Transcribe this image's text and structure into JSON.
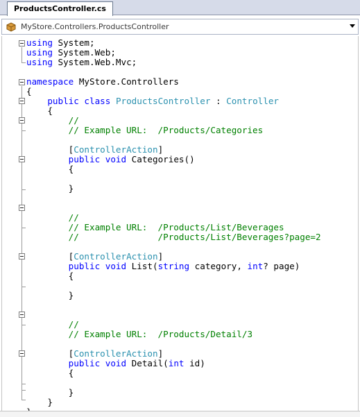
{
  "tab": {
    "title": "ProductsController.cs"
  },
  "navbar": {
    "type_path": "MyStore.Controllers.ProductsController",
    "icon": "class-icon"
  },
  "code_lines": [
    [
      {
        "t": "kw",
        "v": "using"
      },
      {
        "t": "tx",
        "v": " System;"
      }
    ],
    [
      {
        "t": "kw",
        "v": "using"
      },
      {
        "t": "tx",
        "v": " System.Web;"
      }
    ],
    [
      {
        "t": "kw",
        "v": "using"
      },
      {
        "t": "tx",
        "v": " System.Web.Mvc;"
      }
    ],
    [],
    [
      {
        "t": "kw",
        "v": "namespace"
      },
      {
        "t": "tx",
        "v": " MyStore.Controllers"
      }
    ],
    [
      {
        "t": "tx",
        "v": "{"
      }
    ],
    [
      {
        "t": "tx",
        "v": "    "
      },
      {
        "t": "kw",
        "v": "public class"
      },
      {
        "t": "tx",
        "v": " "
      },
      {
        "t": "ty",
        "v": "ProductsController"
      },
      {
        "t": "tx",
        "v": " : "
      },
      {
        "t": "ty",
        "v": "Controller"
      }
    ],
    [
      {
        "t": "tx",
        "v": "    {"
      }
    ],
    [
      {
        "t": "cm",
        "v": "        //"
      }
    ],
    [
      {
        "t": "cm",
        "v": "        // Example URL:  /Products/Categories"
      }
    ],
    [],
    [
      {
        "t": "tx",
        "v": "        ["
      },
      {
        "t": "ty",
        "v": "ControllerAction"
      },
      {
        "t": "tx",
        "v": "]"
      }
    ],
    [
      {
        "t": "tx",
        "v": "        "
      },
      {
        "t": "kw",
        "v": "public void"
      },
      {
        "t": "tx",
        "v": " Categories()"
      }
    ],
    [
      {
        "t": "tx",
        "v": "        {"
      }
    ],
    [],
    [
      {
        "t": "tx",
        "v": "        }"
      }
    ],
    [],
    [],
    [
      {
        "t": "cm",
        "v": "        //"
      }
    ],
    [
      {
        "t": "cm",
        "v": "        // Example URL:  /Products/List/Beverages"
      }
    ],
    [
      {
        "t": "cm",
        "v": "        //               /Products/List/Beverages?page=2"
      }
    ],
    [],
    [
      {
        "t": "tx",
        "v": "        ["
      },
      {
        "t": "ty",
        "v": "ControllerAction"
      },
      {
        "t": "tx",
        "v": "]"
      }
    ],
    [
      {
        "t": "tx",
        "v": "        "
      },
      {
        "t": "kw",
        "v": "public void"
      },
      {
        "t": "tx",
        "v": " List("
      },
      {
        "t": "kw",
        "v": "string"
      },
      {
        "t": "tx",
        "v": " category, "
      },
      {
        "t": "kw",
        "v": "int"
      },
      {
        "t": "tx",
        "v": "? page)"
      }
    ],
    [
      {
        "t": "tx",
        "v": "        {"
      }
    ],
    [],
    [
      {
        "t": "tx",
        "v": "        }"
      }
    ],
    [],
    [],
    [
      {
        "t": "cm",
        "v": "        //"
      }
    ],
    [
      {
        "t": "cm",
        "v": "        // Example URL:  /Products/Detail/3"
      }
    ],
    [],
    [
      {
        "t": "tx",
        "v": "        ["
      },
      {
        "t": "ty",
        "v": "ControllerAction"
      },
      {
        "t": "tx",
        "v": "]"
      }
    ],
    [
      {
        "t": "tx",
        "v": "        "
      },
      {
        "t": "kw",
        "v": "public void"
      },
      {
        "t": "tx",
        "v": " Detail("
      },
      {
        "t": "kw",
        "v": "int"
      },
      {
        "t": "tx",
        "v": " id)"
      }
    ],
    [
      {
        "t": "tx",
        "v": "        {"
      }
    ],
    [],
    [
      {
        "t": "tx",
        "v": "        }"
      }
    ],
    [
      {
        "t": "tx",
        "v": "    }"
      }
    ],
    [
      {
        "t": "tx",
        "v": "}"
      }
    ]
  ],
  "colors": {
    "keyword": "#0000ff",
    "type": "#2b91af",
    "comment": "#008000",
    "text": "#000000"
  }
}
